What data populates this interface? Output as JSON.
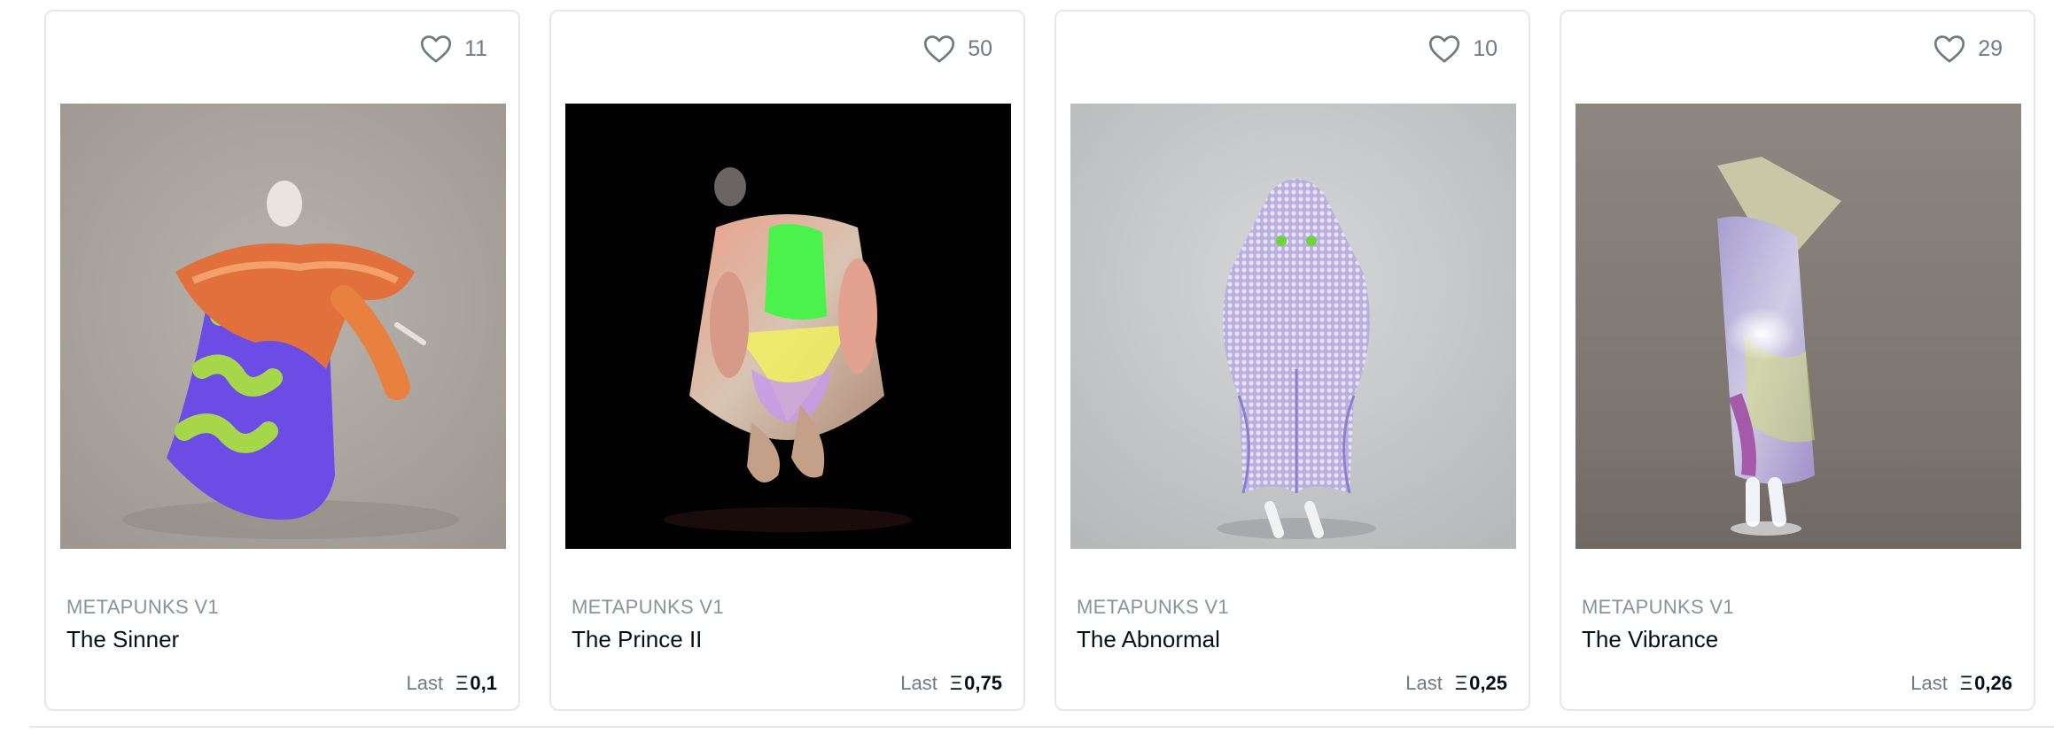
{
  "cards": [
    {
      "likes": "11",
      "collection": "METAPUNKS V1",
      "title": "The Sinner",
      "price_label": "Last",
      "eth_symbol": "Ξ",
      "price": "0,1"
    },
    {
      "likes": "50",
      "collection": "METAPUNKS V1",
      "title": "The Prince II",
      "price_label": "Last",
      "eth_symbol": "Ξ",
      "price": "0,75"
    },
    {
      "likes": "10",
      "collection": "METAPUNKS V1",
      "title": "The Abnormal",
      "price_label": "Last",
      "eth_symbol": "Ξ",
      "price": "0,25"
    },
    {
      "likes": "29",
      "collection": "METAPUNKS V1",
      "title": "The Vibrance",
      "price_label": "Last",
      "eth_symbol": "Ξ",
      "price": "0,26"
    }
  ],
  "colors": {
    "border": "#e5e8eb",
    "muted_text": "#707a83",
    "collection_text": "#8a939b",
    "title_text": "#04111d"
  },
  "icons": {
    "favorite": "heart-outline-icon",
    "currency": "ethereum-symbol"
  }
}
